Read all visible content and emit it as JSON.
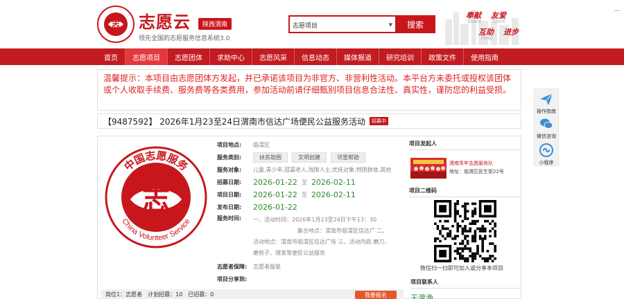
{
  "header": {
    "brand": "志愿云",
    "region": "陕西渭南",
    "slogan": "领先全国的志愿服务信息系统3.0",
    "search_select": "志愿项目",
    "search_button": "搜索",
    "motto": [
      {
        "cn": "奉献",
        "en": "Share"
      },
      {
        "cn": "友爱",
        "en": "Love"
      },
      {
        "cn": "互助",
        "en": "Help"
      },
      {
        "cn": "进步",
        "en": ""
      }
    ]
  },
  "nav": {
    "items": [
      {
        "label": "首页"
      },
      {
        "label": "志愿项目",
        "active": true
      },
      {
        "label": "志愿团体"
      },
      {
        "label": "求助中心"
      },
      {
        "label": "志愿风采"
      },
      {
        "label": "信息动态"
      },
      {
        "label": "媒体报道"
      },
      {
        "label": "研究培训"
      },
      {
        "label": "政策文件"
      },
      {
        "label": "使用指南"
      }
    ]
  },
  "notice": "温馨提示：本项目由志愿团体方发起，并已承诺该项目为非官方、非营利性活动。本平台方未委托或授权该团体或个人收取手续费、服务费等各类费用，参加活动前请仔细甄别项目信息合法性、真实性，谨防您的利益受损。",
  "project": {
    "title": "【9487592】 2026年1月23至24日渭南市信达广场便民公益服务活动",
    "status_badge": "招募中",
    "labels": {
      "location": "项目地点:",
      "category": "服务类别:",
      "target": "服务对象:",
      "recruit_date": "招募日期:",
      "project_date": "项目日期:",
      "publish_date": "发布日期:",
      "service_time": "服务时间:",
      "guarantee": "志愿者保障:",
      "share": "项目分享到:"
    },
    "location": "临渭区",
    "categories": [
      "扶贫助困",
      "文明创建",
      "邻里帮助"
    ],
    "target": "儿童,青少年,孤寡老人,残障人士,优抚对象,特困群体,其他",
    "recruit_start": "2026-01-22",
    "recruit_end": "2026-02-11",
    "project_start": "2026-01-22",
    "project_end": "2026-02-11",
    "publish_date": "2026-01-22",
    "date_sep": "至",
    "service_time_lines": [
      "一、活动时间：2026年1月23至24日下午13：30",
      "集合地点：渭南市临渭区信达广 二、",
      "活动地点：渭南市临渭区信达广场 三、活动内容:磨刀、",
      "磨剪子、理发等便民公益服务"
    ],
    "guarantee": "志愿者服装",
    "post_bar": "岗位1：志愿者　计划招募：10　已招募：0",
    "post_button": "我要报名"
  },
  "sidebar": {
    "sponsor_title": "项目发起人",
    "org_name": "渭南青年志愿服务队",
    "org_addr": "地址：临渭区民生街22号",
    "qr_title": "项目二维码",
    "qr_caption": "微信扫一扫即可加入或分享本项目",
    "contact_title": "项目联系人",
    "contact_name": "王渡渔"
  },
  "float_bar": {
    "items": [
      {
        "label": "操作指南",
        "icon": "paper-plane-icon"
      },
      {
        "label": "微信咨询",
        "icon": "wechat-icon"
      },
      {
        "label": "小程序",
        "icon": "mini-program-icon"
      }
    ]
  },
  "seal_text": {
    "cn": "中国志愿服务",
    "en": "China Volunteer Service",
    "center": "志"
  },
  "colors": {
    "brand_red": "#c8161d",
    "nav_red": "#c21b20",
    "date_green": "#2e8b2e"
  }
}
